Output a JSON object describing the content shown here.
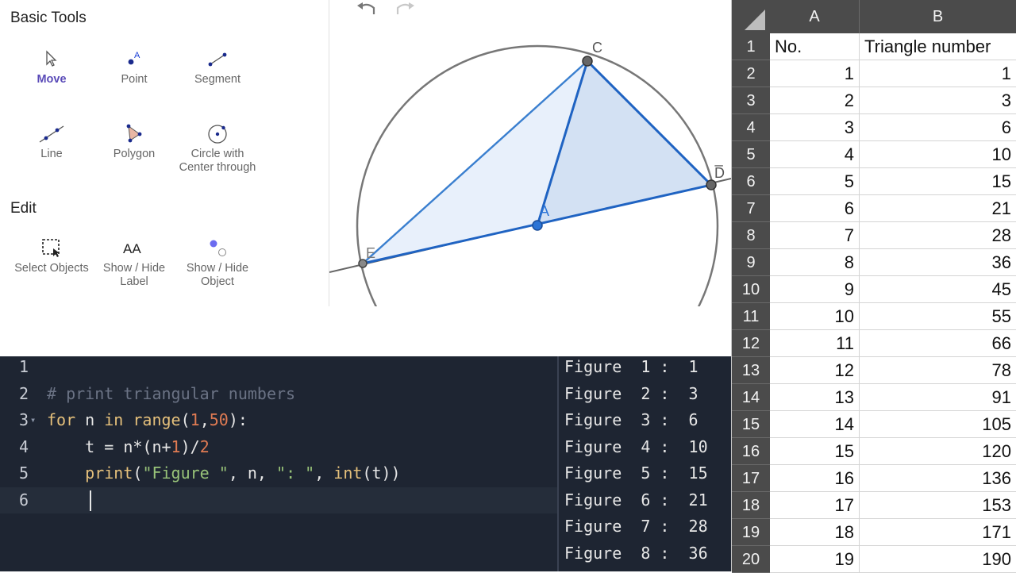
{
  "tools_panel": {
    "headings": [
      "Basic Tools",
      "Edit"
    ],
    "tools": [
      {
        "label": "Move",
        "icon": "cursor-arrow-icon",
        "active": true
      },
      {
        "label": "Point",
        "icon": "point-icon"
      },
      {
        "label": "Segment",
        "icon": "segment-icon"
      },
      {
        "label": "Line",
        "icon": "line-icon"
      },
      {
        "label": "Polygon",
        "icon": "polygon-icon"
      },
      {
        "label": "Circle with Center through",
        "icon": "circle-icon"
      },
      {
        "label": "Select Objects",
        "icon": "select-objects-icon"
      },
      {
        "label": "Show / Hide Label",
        "icon": "show-hide-label-icon"
      },
      {
        "label": "Show / Hide Object",
        "icon": "show-hide-object-icon"
      }
    ],
    "icon_labels": {
      "point_letter": "A",
      "label_letters": "AA"
    },
    "accent_color": "#5a4bb8"
  },
  "graphics": {
    "undo_icon": "undo-icon",
    "redo_icon": "redo-icon",
    "point_labels": {
      "A": "A",
      "C": "C",
      "D": "D̅",
      "E": "E"
    },
    "colors": {
      "polygon_fill": "#dbe6f5",
      "edge": "#1f63c2",
      "circle": "#777777"
    }
  },
  "editor": {
    "lines": [
      {
        "num": "1",
        "tokens": []
      },
      {
        "num": "2",
        "tokens": [
          {
            "t": "# print triangular numbers",
            "c": "comment"
          }
        ]
      },
      {
        "num": "3",
        "fold": "▾",
        "tokens": [
          {
            "t": "for",
            "c": "kw"
          },
          {
            "t": " n ",
            "c": "plain"
          },
          {
            "t": "in",
            "c": "kw"
          },
          {
            "t": " ",
            "c": "plain"
          },
          {
            "t": "range",
            "c": "fn"
          },
          {
            "t": "(",
            "c": "plain"
          },
          {
            "t": "1",
            "c": "num"
          },
          {
            "t": ",",
            "c": "plain"
          },
          {
            "t": "50",
            "c": "num"
          },
          {
            "t": "):",
            "c": "plain"
          }
        ]
      },
      {
        "num": "4",
        "tokens": [
          {
            "t": "    t = n*(n+",
            "c": "plain"
          },
          {
            "t": "1",
            "c": "num"
          },
          {
            "t": ")/",
            "c": "plain"
          },
          {
            "t": "2",
            "c": "num"
          }
        ]
      },
      {
        "num": "5",
        "tokens": [
          {
            "t": "    ",
            "c": "plain"
          },
          {
            "t": "print",
            "c": "fn"
          },
          {
            "t": "(",
            "c": "plain"
          },
          {
            "t": "\"Figure \"",
            "c": "str"
          },
          {
            "t": ", n, ",
            "c": "plain"
          },
          {
            "t": "\": \"",
            "c": "str"
          },
          {
            "t": ", ",
            "c": "plain"
          },
          {
            "t": "int",
            "c": "fn"
          },
          {
            "t": "(t))",
            "c": "plain"
          }
        ]
      },
      {
        "num": "6",
        "tokens": [],
        "current": true
      }
    ]
  },
  "output": {
    "lines": [
      "Figure  1 :  1",
      "Figure  2 :  3",
      "Figure  3 :  6",
      "Figure  4 :  10",
      "Figure  5 :  15",
      "Figure  6 :  21",
      "Figure  7 :  28",
      "Figure  8 :  36"
    ]
  },
  "spreadsheet": {
    "columns": [
      "A",
      "B"
    ],
    "header_row": {
      "row": "1",
      "cells": [
        "No.",
        "Triangle number"
      ]
    },
    "rows": [
      {
        "row": "2",
        "cells": [
          "1",
          "1"
        ]
      },
      {
        "row": "3",
        "cells": [
          "2",
          "3"
        ]
      },
      {
        "row": "4",
        "cells": [
          "3",
          "6"
        ]
      },
      {
        "row": "5",
        "cells": [
          "4",
          "10"
        ]
      },
      {
        "row": "6",
        "cells": [
          "5",
          "15"
        ]
      },
      {
        "row": "7",
        "cells": [
          "6",
          "21"
        ]
      },
      {
        "row": "8",
        "cells": [
          "7",
          "28"
        ]
      },
      {
        "row": "9",
        "cells": [
          "8",
          "36"
        ]
      },
      {
        "row": "10",
        "cells": [
          "9",
          "45"
        ]
      },
      {
        "row": "11",
        "cells": [
          "10",
          "55"
        ]
      },
      {
        "row": "12",
        "cells": [
          "11",
          "66"
        ]
      },
      {
        "row": "13",
        "cells": [
          "12",
          "78"
        ]
      },
      {
        "row": "14",
        "cells": [
          "13",
          "91"
        ]
      },
      {
        "row": "15",
        "cells": [
          "14",
          "105"
        ]
      },
      {
        "row": "16",
        "cells": [
          "15",
          "120"
        ]
      },
      {
        "row": "17",
        "cells": [
          "16",
          "136"
        ]
      },
      {
        "row": "18",
        "cells": [
          "17",
          "153"
        ]
      },
      {
        "row": "19",
        "cells": [
          "18",
          "171"
        ]
      },
      {
        "row": "20",
        "cells": [
          "19",
          "190"
        ]
      }
    ]
  }
}
